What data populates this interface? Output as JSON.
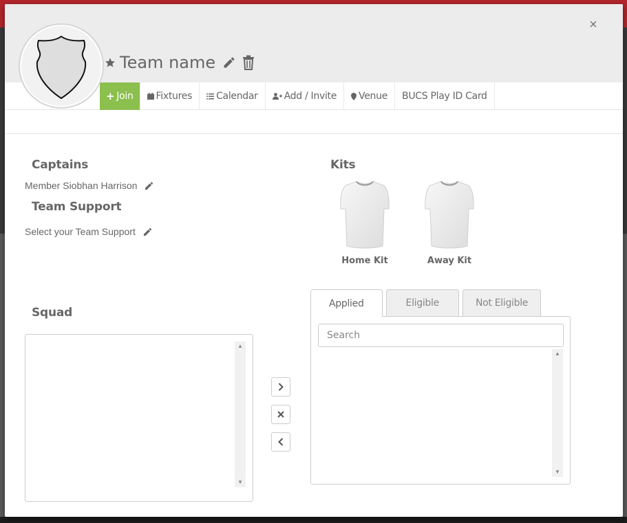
{
  "team": {
    "name": "Team name"
  },
  "nav": {
    "join": "Join",
    "fixtures": "Fixtures",
    "calendar": "Calendar",
    "add_invite": "Add / Invite",
    "venue": "Venue",
    "bucs_card": "BUCS Play ID Card"
  },
  "captains": {
    "heading": "Captains",
    "member": "Member Siobhan Harrison"
  },
  "support": {
    "heading": "Team Support",
    "placeholder": "Select your Team Support"
  },
  "kits": {
    "heading": "Kits",
    "home": "Home Kit",
    "away": "Away Kit"
  },
  "squad": {
    "heading": "Squad"
  },
  "tabs": {
    "applied": "Applied",
    "eligible": "Eligible",
    "not_eligible": "Not Eligible"
  },
  "search": {
    "placeholder": "Search",
    "value": ""
  },
  "colors": {
    "accent": "#8bbf4e",
    "header_bg": "#ececec"
  }
}
